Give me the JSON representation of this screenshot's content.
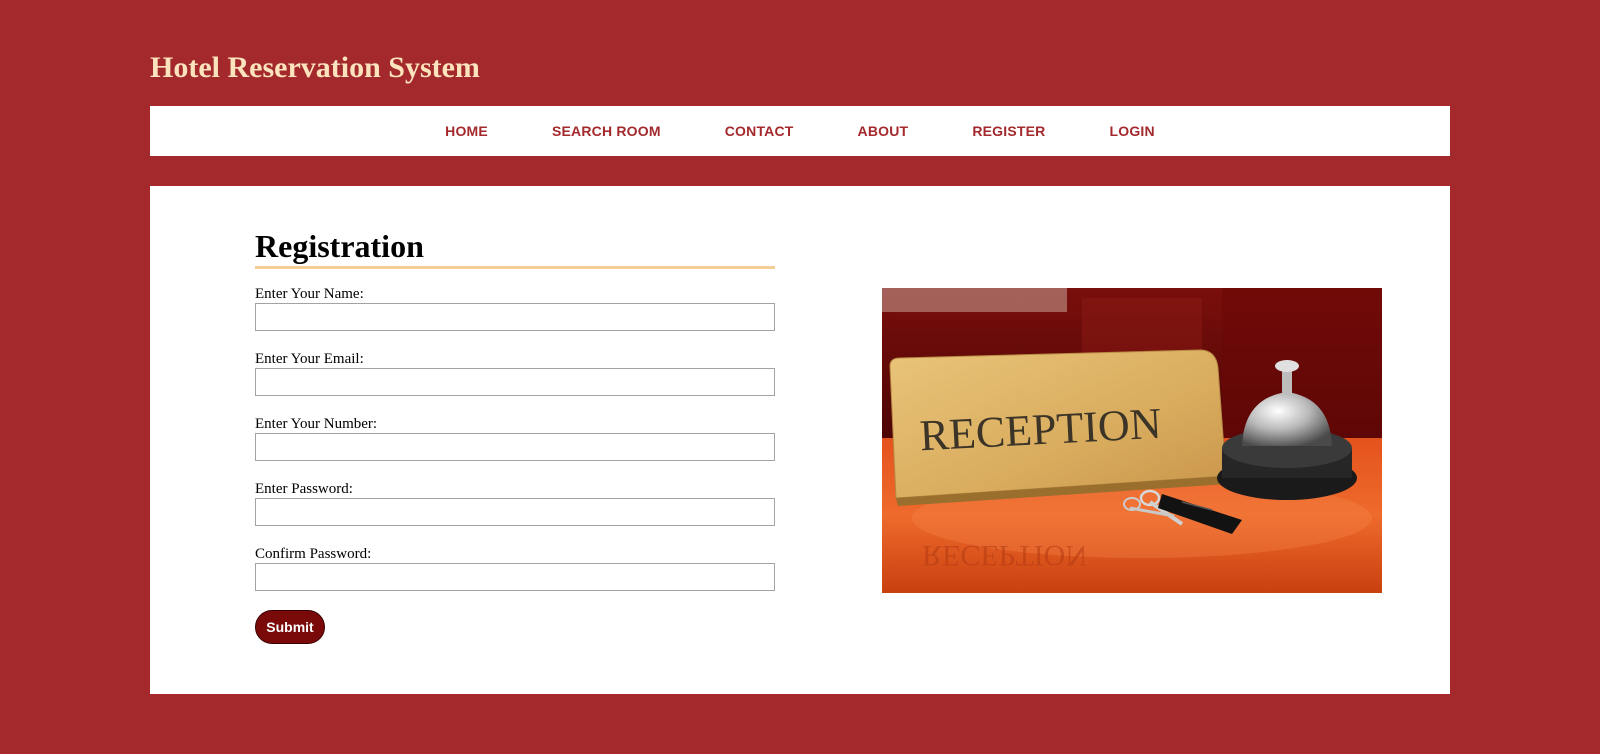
{
  "site": {
    "title": "Hotel Reservation System"
  },
  "nav": {
    "items": [
      "HOME",
      "SEARCH ROOM",
      "CONTACT",
      "ABOUT",
      "REGISTER",
      "LOGIN"
    ]
  },
  "form": {
    "heading": "Registration",
    "fields": [
      {
        "label": "Enter Your Name:",
        "value": ""
      },
      {
        "label": "Enter Your Email:",
        "value": ""
      },
      {
        "label": "Enter Your Number:",
        "value": ""
      },
      {
        "label": "Enter Password:",
        "value": ""
      },
      {
        "label": "Confirm Password:",
        "value": ""
      }
    ],
    "submit_label": "Submit"
  },
  "image": {
    "sign_text": "RECEPTION"
  },
  "colors": {
    "page_background": "#a3292c",
    "title_color": "#fbe3bd",
    "nav_text": "#a3292c",
    "heading_underline": "#f3cf96",
    "submit_background": "#7a0a0a"
  }
}
